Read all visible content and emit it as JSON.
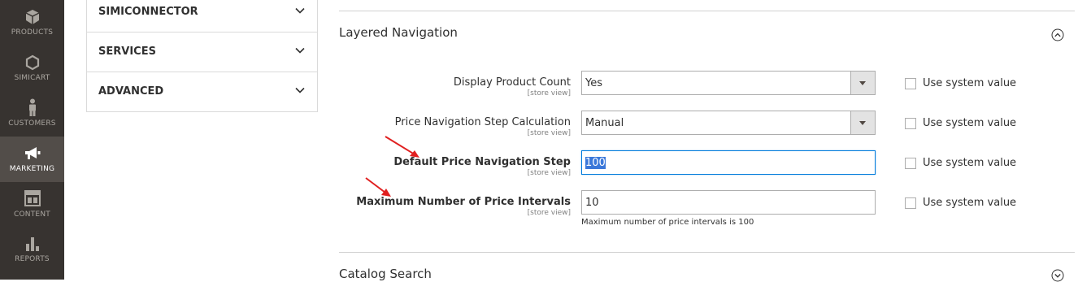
{
  "nav": {
    "items": [
      {
        "label": "PRODUCTS",
        "icon": "cube-icon"
      },
      {
        "label": "SIMICART",
        "icon": "hexagon-icon"
      },
      {
        "label": "CUSTOMERS",
        "icon": "person-icon"
      },
      {
        "label": "MARKETING",
        "icon": "megaphone-icon",
        "active": true
      },
      {
        "label": "CONTENT",
        "icon": "layout-icon"
      },
      {
        "label": "REPORTS",
        "icon": "bar-chart-icon"
      }
    ]
  },
  "tabs": [
    "SIMICONNECTOR",
    "SERVICES",
    "ADVANCED"
  ],
  "section": {
    "title": "Layered Navigation",
    "next_title": "Catalog Search"
  },
  "fields": [
    {
      "label": "Display Product Count",
      "scope": "[store view]",
      "value": "Yes",
      "type": "select",
      "use_system_value": "Use system value"
    },
    {
      "label": "Price Navigation Step Calculation",
      "scope": "[store view]",
      "value": "Manual",
      "type": "select",
      "use_system_value": "Use system value"
    },
    {
      "label": "Default Price Navigation Step",
      "scope": "[store view]",
      "value": "100",
      "type": "text",
      "use_system_value": "Use system value"
    },
    {
      "label": "Maximum Number of Price Intervals",
      "scope": "[store view]",
      "value": "10",
      "type": "text",
      "use_system_value": "Use system value",
      "note": "Maximum number of price intervals is 100"
    }
  ],
  "colors": {
    "nav_bg": "#373330",
    "nav_active": "#524d49",
    "annotation_arrow": "#e02020",
    "focus": "#007bdb"
  }
}
